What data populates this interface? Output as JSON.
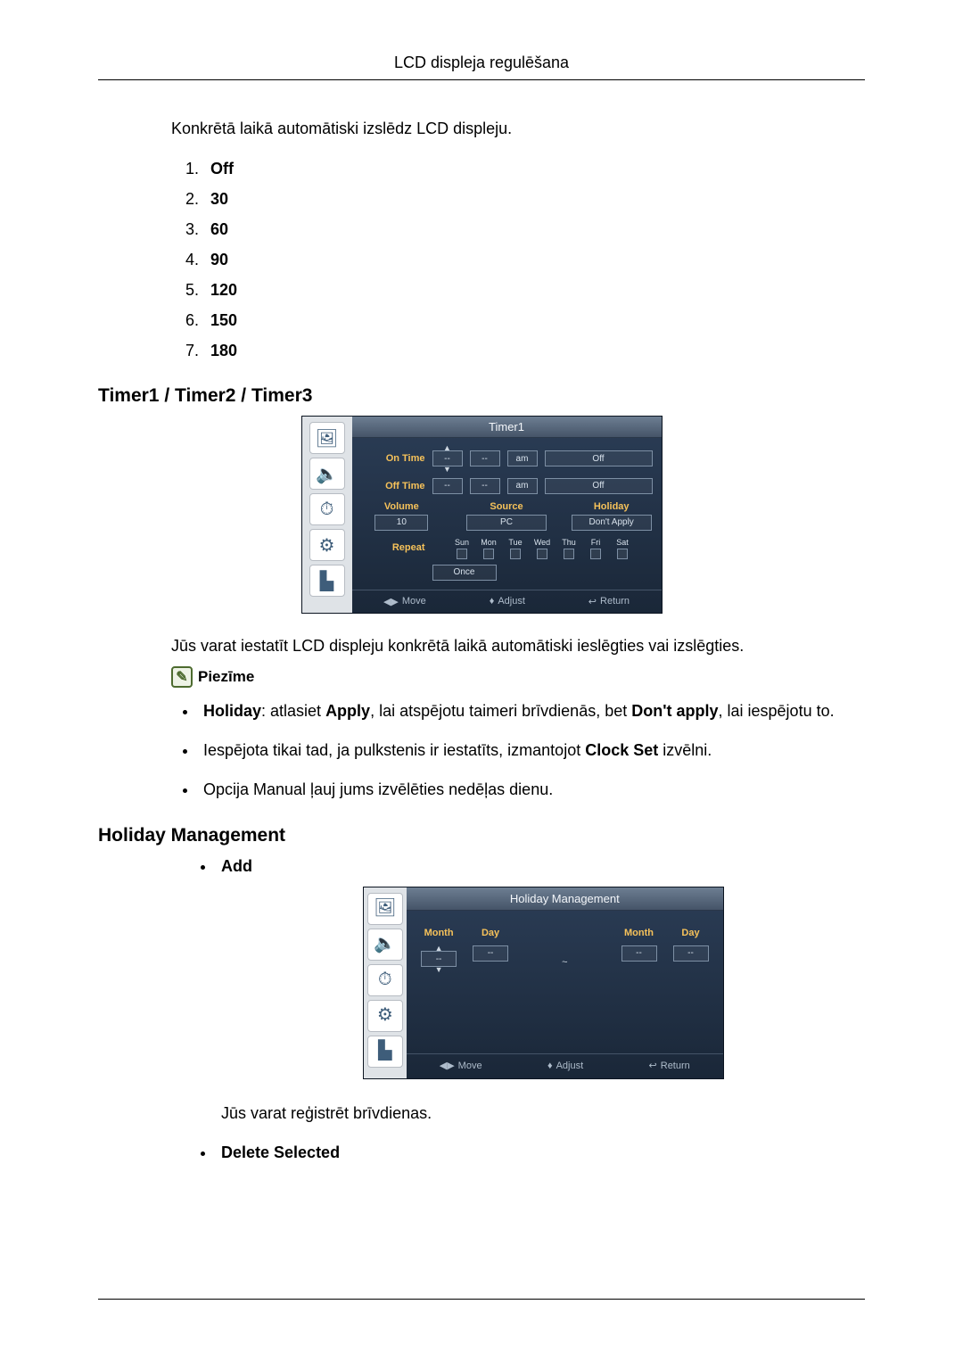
{
  "header": "LCD displeja regulēšana",
  "intro": "Konkrētā laikā automātiski izslēdz LCD displeju.",
  "auto_off_options": [
    "Off",
    "30",
    "60",
    "90",
    "120",
    "150",
    "180"
  ],
  "timer_section_title": "Timer1 / Timer2 / Timer3",
  "timer_osd": {
    "title": "Timer1",
    "on_time_label": "On Time",
    "off_time_label": "Off Time",
    "field_placeholder": "--",
    "ampm": "am",
    "status_off": "Off",
    "volume_label": "Volume",
    "volume_value": "10",
    "source_label": "Source",
    "source_value": "PC",
    "holiday_label": "Holiday",
    "holiday_value": "Don't Apply",
    "repeat_label": "Repeat",
    "repeat_value": "Once",
    "days": [
      "Sun",
      "Mon",
      "Tue",
      "Wed",
      "Thu",
      "Fri",
      "Sat"
    ],
    "footer_move": "Move",
    "footer_adjust": "Adjust",
    "footer_return": "Return"
  },
  "timer_para": "Jūs varat iestatīt LCD displeju konkrētā laikā automātiski ieslēgties vai izslēgties.",
  "note_label": "Piezīme",
  "note_bullets": [
    {
      "pre": "",
      "b1": "Holiday",
      "mid1": ": atlasiet ",
      "b2": "Apply",
      "mid2": ", lai atspējotu taimeri brīvdienās, bet ",
      "b3": "Don't apply",
      "post": ", lai iespējotu to."
    },
    {
      "plain_pre": "Iespējota tikai tad, ja pulkstenis ir iestatīts, izmantojot ",
      "b1": "Clock Set",
      "plain_post": " izvēlni."
    },
    {
      "plain": "Opcija Manual ļauj jums izvēlēties nedēļas dienu."
    }
  ],
  "holiday_section_title": "Holiday Management",
  "holiday_add_label": "Add",
  "holiday_osd": {
    "title": "Holiday Management",
    "month_label": "Month",
    "day_label": "Day",
    "field_placeholder": "--",
    "sep": "~",
    "footer_move": "Move",
    "footer_adjust": "Adjust",
    "footer_return": "Return"
  },
  "holiday_para": "Jūs varat reģistrēt brīvdienas.",
  "delete_selected_label": "Delete Selected"
}
